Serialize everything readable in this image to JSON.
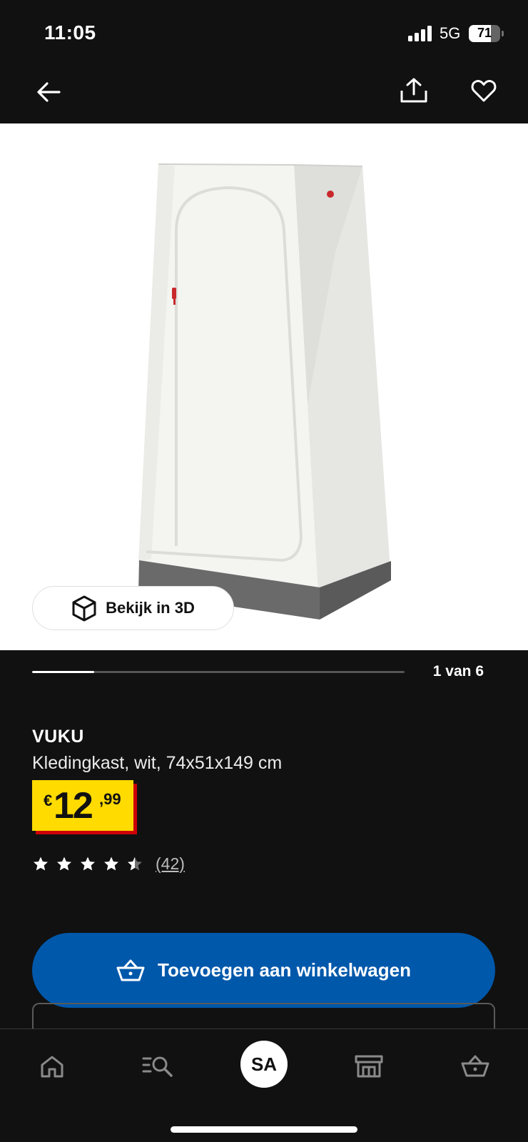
{
  "status_bar": {
    "time": "11:05",
    "network": "5G",
    "battery": "71",
    "battery_level": 0.71
  },
  "top_bar": {
    "back_icon": "arrow-left-icon",
    "share_icon": "share-icon",
    "favorite_icon": "heart-icon"
  },
  "gallery": {
    "view_3d_label": "Bekijk in 3D",
    "view_3d_icon": "cube-icon",
    "pager_text": "1 van 6",
    "current_index": 1,
    "total": 6
  },
  "product": {
    "name": "VUKU",
    "description": "Kledingkast, wit, 74x51x149 cm",
    "price": {
      "currency": "€",
      "integer": "12",
      "decimals": ",99",
      "background": "#ffdb00",
      "shadow": "#cc0008"
    },
    "rating": {
      "value": 4.5,
      "max": 5,
      "review_count": "(42)"
    }
  },
  "cta": {
    "label": "Toevoegen aan winkelwagen",
    "icon": "basket-icon",
    "color": "#0058ab"
  },
  "bottom_nav": {
    "items": [
      {
        "icon": "home-icon"
      },
      {
        "icon": "search-list-icon"
      },
      {
        "avatar_initials": "SA"
      },
      {
        "icon": "store-icon"
      },
      {
        "icon": "basket-icon"
      }
    ]
  }
}
